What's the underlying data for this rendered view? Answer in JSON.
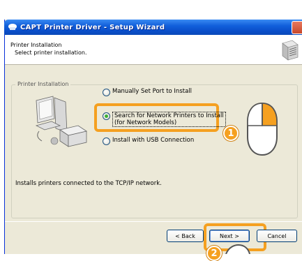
{
  "window": {
    "title": "CAPT Printer Driver - Setup Wizard"
  },
  "header": {
    "title": "Printer Installation",
    "subtitle": "Select printer installation."
  },
  "group": {
    "legend": "Printer Installation"
  },
  "options": [
    {
      "label": "Manually Set Port to Install",
      "selected": false
    },
    {
      "label_line1": "Search for Network Printers to Install",
      "label_line2": "(for Network Models)",
      "selected": true
    },
    {
      "label": "Install with USB Connection",
      "selected": false
    }
  ],
  "description": "Installs printers connected to the TCP/IP network.",
  "buttons": {
    "back": "< Back",
    "next": "Next >",
    "cancel": "Cancel"
  },
  "callouts": {
    "step1": "1",
    "step2": "2"
  },
  "colors": {
    "highlight": "#f5a020",
    "titlebar": "#0a4ec9"
  }
}
